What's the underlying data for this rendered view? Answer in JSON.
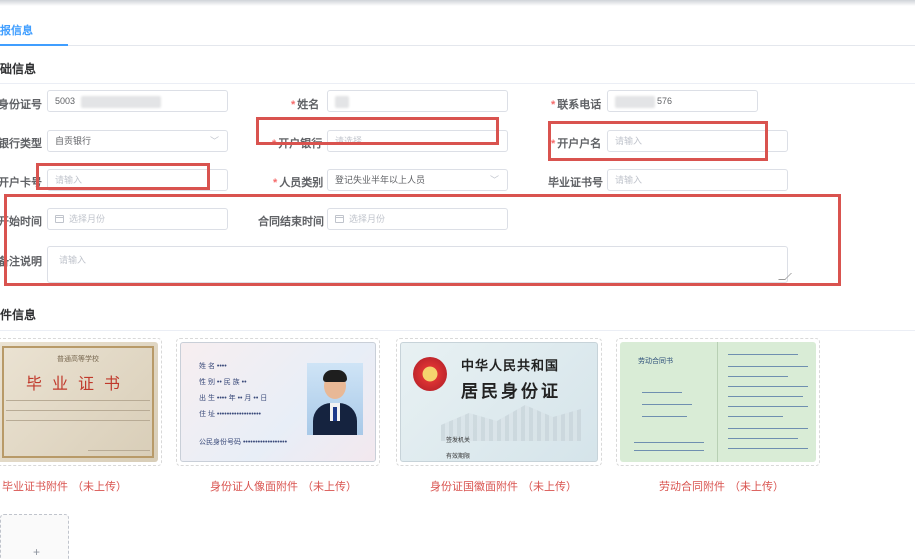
{
  "tab": {
    "label": "报信息"
  },
  "sections": {
    "basic": "础信息",
    "attachments": "件信息"
  },
  "form": {
    "id_no": {
      "label": "身份证号",
      "value": "5003",
      "required": true
    },
    "name": {
      "label": "姓名",
      "value": "",
      "required": true
    },
    "phone": {
      "label": "联系电话",
      "value": "576",
      "required": true
    },
    "bank_type": {
      "label": "银行类型",
      "value": "自贡银行",
      "required": false
    },
    "bank": {
      "label": "开户银行",
      "placeholder": "请选择",
      "required": true
    },
    "account_name": {
      "label": "开户户名",
      "placeholder": "请输入",
      "required": true
    },
    "account_no": {
      "label": "开户卡号",
      "placeholder": "请输入",
      "required": false
    },
    "person_type": {
      "label": "人员类别",
      "value": "登记失业半年以上人员",
      "required": true
    },
    "cert_no": {
      "label": "毕业证书号",
      "placeholder": "请输入",
      "required": false
    },
    "contract_start": {
      "label": "开始时间",
      "placeholder": "选择月份",
      "required": false
    },
    "contract_end": {
      "label": "合同结束时间",
      "placeholder": "选择月份",
      "required": false
    },
    "remark": {
      "label": "备注说明",
      "placeholder": "请输入",
      "required": false
    }
  },
  "attachments": [
    {
      "name": "毕业证书附件",
      "status": "（未上传）"
    },
    {
      "name": "身份证人像面附件",
      "status": "（未上传）"
    },
    {
      "name": "身份证国徽面附件",
      "status": "（未上传）"
    },
    {
      "name": "劳动合同附件",
      "status": "（未上传）"
    }
  ],
  "samples": {
    "certificate": {
      "school": "普通高等学校",
      "title": "毕业证书"
    },
    "id_front": {
      "rows": [
        "姓 名 ••••",
        "性 别 ••  民 族 ••",
        "出 生 ••••  年 •• 月 •• 日",
        "住 址 ••••••••••••••••••"
      ],
      "number": "公民身份号码  ••••••••••••••••••"
    },
    "id_back": {
      "line1": "中华人民共和国",
      "line2": "居民身份证",
      "issuer": "签发机关",
      "validity": "有效期限"
    },
    "contract": {
      "title": "劳动合同书"
    }
  },
  "colors": {
    "accent": "#409eff",
    "required": "#f56c6c",
    "highlight": "#d9534f"
  }
}
